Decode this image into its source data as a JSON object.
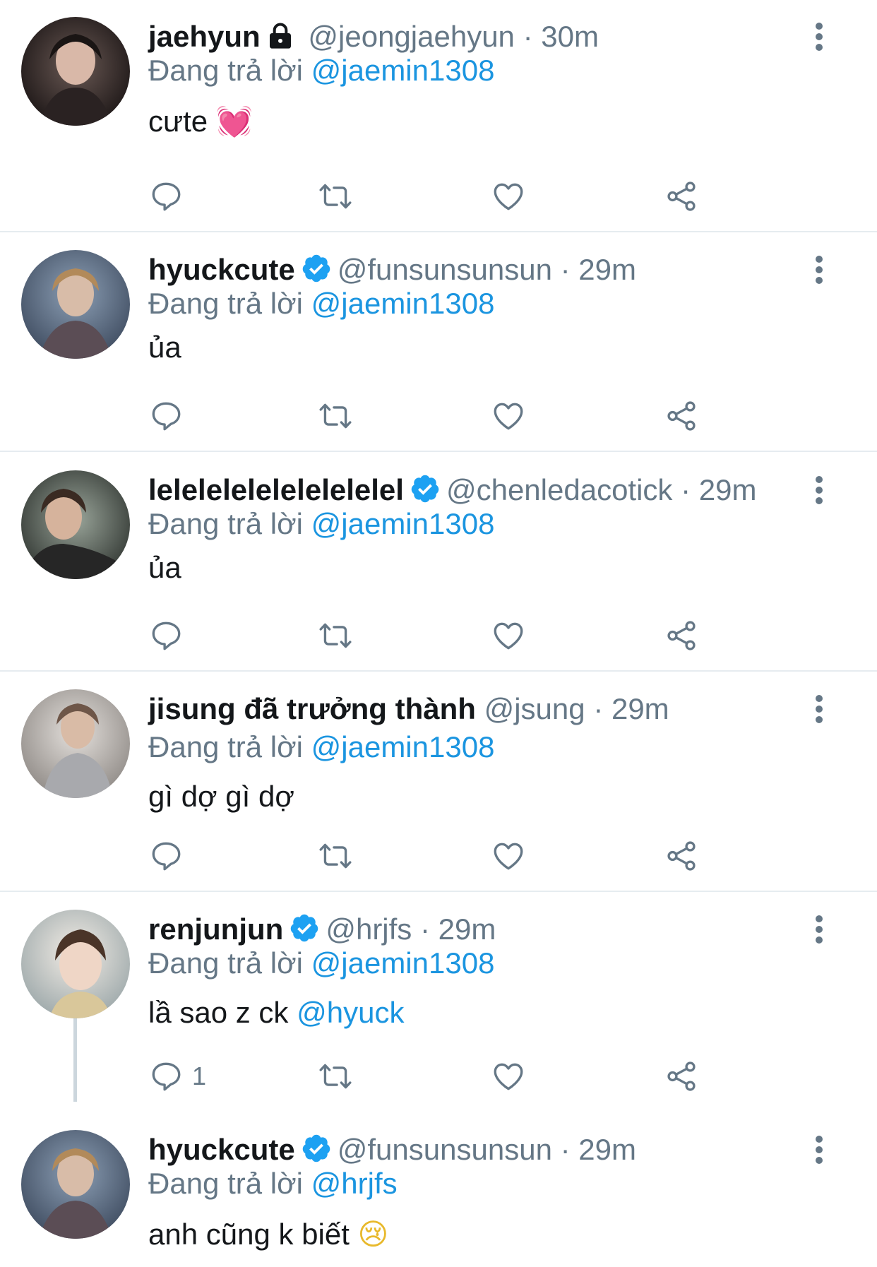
{
  "colors": {
    "accent": "#1b95e0",
    "muted": "#657786",
    "text": "#14171a",
    "divider": "#e6ecf0",
    "verified": "#1da1f2"
  },
  "reply_prefix": "Đang trả lời",
  "tweets": [
    {
      "name": "jaehyun",
      "badge": "lock-icon",
      "handle": "@jeongjaehyun",
      "time": "· 30m",
      "replying_to": "@jaemin1308",
      "text": "cưte",
      "emoji": "💓",
      "mention_in_text": "",
      "reply_count": ""
    },
    {
      "name": "hyuckcute",
      "badge": "verified-icon",
      "handle": "@funsunsunsun",
      "time": "· 29m",
      "replying_to": "@jaemin1308",
      "text": "ủa",
      "emoji": "",
      "mention_in_text": "",
      "reply_count": ""
    },
    {
      "name": "lelelelelelelelelelel",
      "badge": "verified-icon",
      "handle": "@chenledacotick",
      "time": "· 29m",
      "replying_to": "@jaemin1308",
      "text": "ủa",
      "emoji": "",
      "mention_in_text": "",
      "reply_count": ""
    },
    {
      "name": "jisung đã trưởng thành",
      "badge": "",
      "handle": "@jsung",
      "time": "· 29m",
      "replying_to": "@jaemin1308",
      "text": "gì dợ gì dợ",
      "emoji": "",
      "mention_in_text": "",
      "reply_count": ""
    },
    {
      "name": "renjunjun",
      "badge": "verified-icon",
      "handle": "@hrjfs",
      "time": "· 29m",
      "replying_to": "@jaemin1308",
      "text": "lầ sao z ck",
      "emoji": "",
      "mention_in_text": "@hyuck",
      "reply_count": "1"
    },
    {
      "name": "hyuckcute",
      "badge": "verified-icon",
      "handle": "@funsunsunsun",
      "time": "· 29m",
      "replying_to": "@hrjfs",
      "text": "anh cũng k biết",
      "emoji": "😢",
      "mention_in_text": "",
      "reply_count": ""
    }
  ]
}
